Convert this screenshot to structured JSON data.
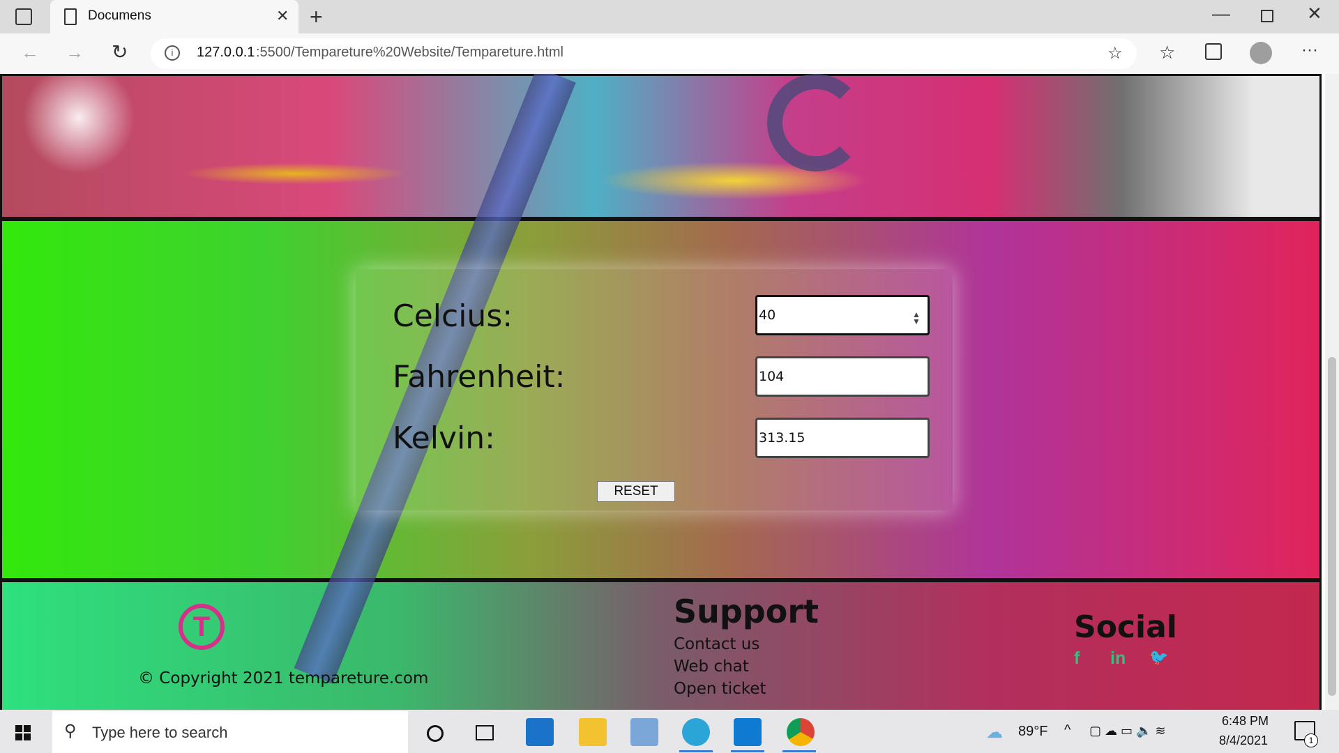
{
  "browser": {
    "tab_title": "Documens",
    "url_host": "127.0.0.1",
    "url_path": ":5500/Tempareture%20Website/Tempareture.html",
    "new_tab_label": "+",
    "close_tab_label": "✕"
  },
  "converter": {
    "celsius_label": "Celcius:",
    "celsius_value": "40",
    "fahrenheit_label": "Fahrenheit:",
    "fahrenheit_value": "104",
    "kelvin_label": "Kelvin:",
    "kelvin_value": "313.15",
    "reset_label": "RESET"
  },
  "footer": {
    "logo_letter": "T",
    "copyright": "© Copyright 2021 tempareture.com",
    "support_title": "Support",
    "support_links": [
      "Contact us",
      "Web chat",
      "Open ticket"
    ],
    "social_title": "Social",
    "social_icons": [
      "facebook-icon",
      "linkedin-icon",
      "twitter-icon"
    ],
    "social_glyphs": [
      "f",
      "in",
      "🐦"
    ]
  },
  "taskbar": {
    "search_placeholder": "Type here to search",
    "weather": "89°F",
    "time": "6:48 PM",
    "date": "8/4/2021",
    "notification_count": "1"
  }
}
